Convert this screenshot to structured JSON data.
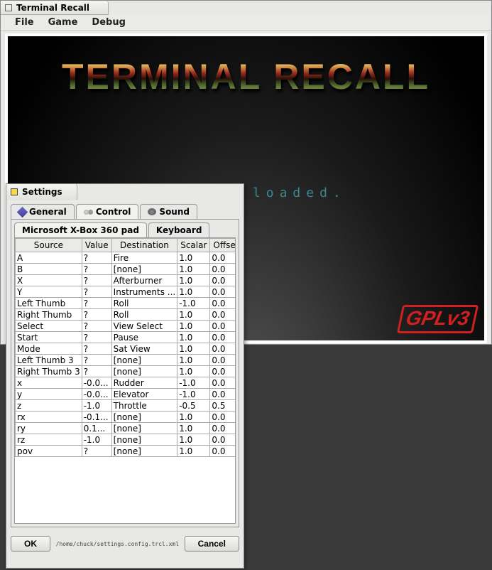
{
  "window": {
    "title": "Terminal Recall"
  },
  "menubar": [
    {
      "label": "File"
    },
    {
      "label": "Game"
    },
    {
      "label": "Debug"
    }
  ],
  "game": {
    "logo": "TERMINAL RECALL",
    "status": "No game loaded.",
    "gpl_text": "GPL"
  },
  "settings": {
    "title": "Settings",
    "main_tabs": {
      "general": "General",
      "control": "Control",
      "sound": "Sound"
    },
    "sub_tabs": {
      "pad": "Microsoft X-Box 360 pad",
      "keyboard": "Keyboard"
    },
    "columns": [
      "Source",
      "Value",
      "Destination",
      "Scalar",
      "Offset"
    ],
    "rows": [
      {
        "src": "A",
        "val": "?",
        "dst": "Fire",
        "sca": "1.0",
        "off": "0.0"
      },
      {
        "src": "B",
        "val": "?",
        "dst": "[none]",
        "sca": "1.0",
        "off": "0.0"
      },
      {
        "src": "X",
        "val": "?",
        "dst": "Afterburner",
        "sca": "1.0",
        "off": "0.0"
      },
      {
        "src": "Y",
        "val": "?",
        "dst": "Instruments ...",
        "sca": "1.0",
        "off": "0.0"
      },
      {
        "src": "Left Thumb",
        "val": "?",
        "dst": "Roll",
        "sca": "-1.0",
        "off": "0.0"
      },
      {
        "src": "Right Thumb",
        "val": "?",
        "dst": "Roll",
        "sca": "1.0",
        "off": "0.0"
      },
      {
        "src": "Select",
        "val": "?",
        "dst": "View Select",
        "sca": "1.0",
        "off": "0.0"
      },
      {
        "src": "Start",
        "val": "?",
        "dst": "Pause",
        "sca": "1.0",
        "off": "0.0"
      },
      {
        "src": "Mode",
        "val": "?",
        "dst": "Sat View",
        "sca": "1.0",
        "off": "0.0"
      },
      {
        "src": "Left Thumb 3",
        "val": "?",
        "dst": "[none]",
        "sca": "1.0",
        "off": "0.0"
      },
      {
        "src": "Right Thumb 3",
        "val": "?",
        "dst": "[none]",
        "sca": "1.0",
        "off": "0.0"
      },
      {
        "src": "x",
        "val": "-0.0...",
        "dst": "Rudder",
        "sca": "-1.0",
        "off": "0.0"
      },
      {
        "src": "y",
        "val": "-0.0...",
        "dst": "Elevator",
        "sca": "-1.0",
        "off": "0.0"
      },
      {
        "src": "z",
        "val": "-1.0",
        "dst": "Throttle",
        "sca": "-0.5",
        "off": "0.5"
      },
      {
        "src": "rx",
        "val": "-0.1...",
        "dst": "[none]",
        "sca": "1.0",
        "off": "0.0"
      },
      {
        "src": "ry",
        "val": "0.1...",
        "dst": "[none]",
        "sca": "1.0",
        "off": "0.0"
      },
      {
        "src": "rz",
        "val": "-1.0",
        "dst": "[none]",
        "sca": "1.0",
        "off": "0.0"
      },
      {
        "src": "pov",
        "val": "?",
        "dst": "[none]",
        "sca": "1.0",
        "off": "0.0"
      }
    ],
    "buttons": {
      "ok": "OK",
      "cancel": "Cancel"
    },
    "path": "/home/chuck/settings.config.trcl.xml"
  }
}
